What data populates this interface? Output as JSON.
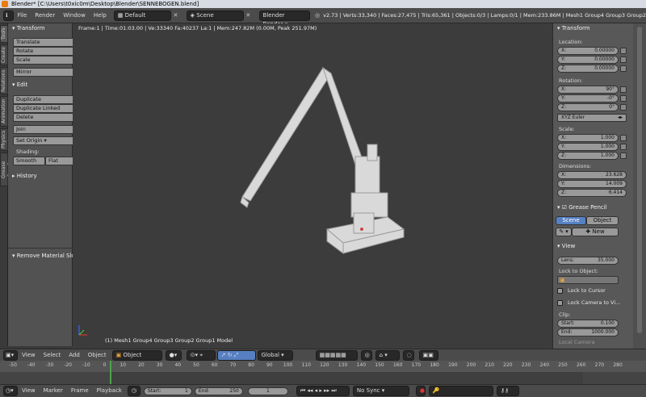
{
  "window": {
    "title": "Blender* [C:\\Users\\t0xic0m\\Desktop\\Blender\\SENNEBOGEN.blend]"
  },
  "info_header": {
    "menus": [
      "File",
      "Render",
      "Window",
      "Help"
    ],
    "screen_layout": "Default",
    "scene": "Scene",
    "render_engine": "Blender Render",
    "stats": "v2.73 | Verts:33,340 | Faces:27,475 | Tris:65,361 | Objects:0/3 | Lamps:0/1 | Mem:233.86M | Mesh1 Group4 Group3 Group2"
  },
  "left_tabs": [
    "Tools",
    "Create",
    "Relations",
    "Animation",
    "Physics",
    "Grease Pencil"
  ],
  "tool_shelf": {
    "transform": {
      "title": "Transform",
      "buttons": [
        "Translate",
        "Rotate",
        "Scale"
      ],
      "mirror": "Mirror"
    },
    "edit": {
      "title": "Edit",
      "buttons": [
        "Duplicate",
        "Duplicate Linked",
        "Delete"
      ],
      "join": "Join",
      "set_origin": "Set Origin",
      "shading_label": "Shading:",
      "smooth": "Smooth",
      "flat": "Flat"
    },
    "history": {
      "title": "History"
    },
    "operator": {
      "title": "Remove Material Slot"
    }
  },
  "viewport": {
    "info": "Frame:1 | Time:01:03.00 | Ve:33340 Fa:40237 La:1 | Mem:247.82M (0.00M, Peak 251.97M)",
    "object_info": "(1) Mesh1 Group4 Group3 Group2 Group1 Model"
  },
  "properties": {
    "transform_title": "Transform",
    "location_label": "Location:",
    "location": [
      {
        "axis": "X:",
        "value": "0.00000"
      },
      {
        "axis": "Y:",
        "value": "0.00000"
      },
      {
        "axis": "Z:",
        "value": "0.00000"
      }
    ],
    "rotation_label": "Rotation:",
    "rotation": [
      {
        "axis": "X:",
        "value": "90°"
      },
      {
        "axis": "Y:",
        "value": "-0°"
      },
      {
        "axis": "Z:",
        "value": "0°"
      }
    ],
    "rotation_mode": "XYZ Euler",
    "scale_label": "Scale:",
    "scale": [
      {
        "axis": "X:",
        "value": "1.000"
      },
      {
        "axis": "Y:",
        "value": "1.000"
      },
      {
        "axis": "Z:",
        "value": "1.000"
      }
    ],
    "dimensions_label": "Dimensions:",
    "dimensions": [
      {
        "axis": "X:",
        "value": "23.628"
      },
      {
        "axis": "Y:",
        "value": "14.009"
      },
      {
        "axis": "Z:",
        "value": "6.414"
      }
    ],
    "grease_pencil_title": "Grease Pencil",
    "gp_scene": "Scene",
    "gp_object": "Object",
    "gp_new": "New",
    "view_title": "View",
    "lens_label": "Lens:",
    "lens_value": "35.000",
    "lock_object_label": "Lock to Object:",
    "lock_cursor": "Lock to Cursor",
    "lock_camera": "Lock Camera to Vi...",
    "clip_label": "Clip:",
    "clip_start_label": "Start:",
    "clip_start": "0.100",
    "clip_end_label": "End:",
    "clip_end": "1000.000",
    "local_camera": "Local Camera"
  },
  "viewport_header": {
    "menus": [
      "View",
      "Select",
      "Add",
      "Object"
    ],
    "mode": "Object Mode",
    "orientation": "Global"
  },
  "timeline": {
    "ticks": [
      "-50",
      "-40",
      "-30",
      "-20",
      "-10",
      "0",
      "10",
      "20",
      "30",
      "40",
      "50",
      "60",
      "70",
      "80",
      "90",
      "100",
      "110",
      "120",
      "130",
      "140",
      "150",
      "160",
      "170",
      "180",
      "190",
      "200",
      "210",
      "220",
      "230",
      "240",
      "250",
      "260",
      "270",
      "280"
    ]
  },
  "timeline_header": {
    "menus": [
      "View",
      "Marker",
      "Frame",
      "Playback"
    ],
    "start_label": "Start:",
    "start": "1",
    "end_label": "End:",
    "end": "250",
    "current": "1",
    "sync": "No Sync"
  }
}
